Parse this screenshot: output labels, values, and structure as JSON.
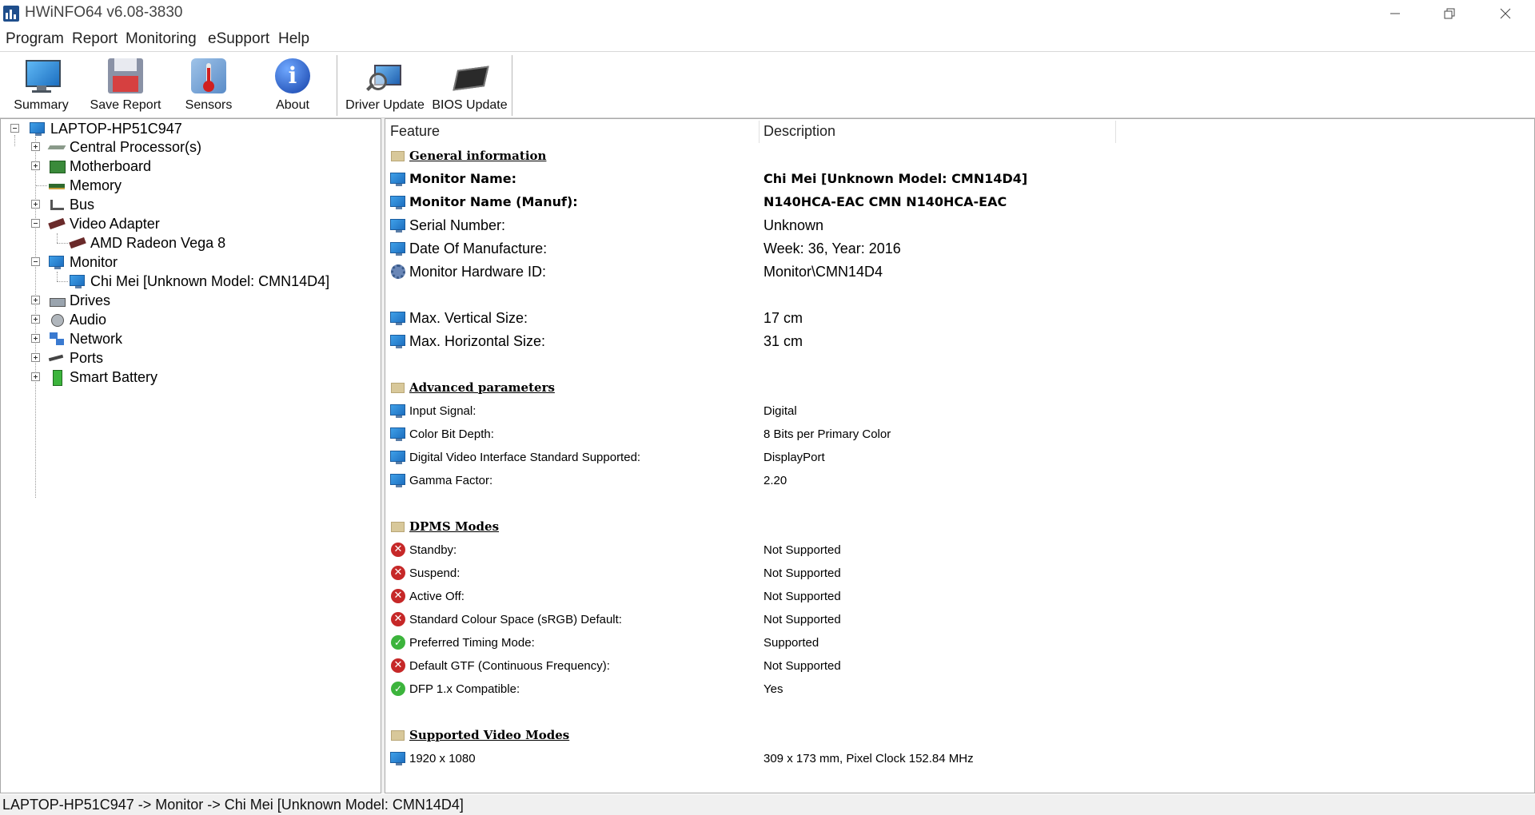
{
  "window": {
    "title": "HWiNFO64 v6.08-3830",
    "controls": [
      "minimize",
      "restore",
      "close"
    ]
  },
  "menu": [
    "Program",
    "Report",
    "Monitoring",
    "eSupport",
    "Help"
  ],
  "toolbar": {
    "buttons": [
      {
        "label": "Summary",
        "icon": "monitor-icon"
      },
      {
        "label": "Save Report",
        "icon": "floppy-disk-icon"
      },
      {
        "label": "Sensors",
        "icon": "thermometer-icon"
      },
      {
        "label": "About",
        "icon": "info-icon"
      },
      {
        "label": "Driver Update",
        "icon": "driver-update-icon"
      },
      {
        "label": "BIOS Update",
        "icon": "bios-chip-icon"
      }
    ]
  },
  "tree": {
    "root": "LAPTOP-HP51C947",
    "items": [
      {
        "label": "Central Processor(s)",
        "icon": "cpu-icon",
        "expander": "plus"
      },
      {
        "label": "Motherboard",
        "icon": "motherboard-icon",
        "expander": "plus"
      },
      {
        "label": "Memory",
        "icon": "memory-icon",
        "expander": "none"
      },
      {
        "label": "Bus",
        "icon": "bus-icon",
        "expander": "plus"
      },
      {
        "label": "Video Adapter",
        "icon": "video-card-icon",
        "expander": "minus"
      },
      {
        "label": "AMD Radeon Vega 8",
        "icon": "video-card-icon",
        "expander": "child"
      },
      {
        "label": "Monitor",
        "icon": "monitor-icon",
        "expander": "minus"
      },
      {
        "label": "Chi Mei [Unknown Model: CMN14D4]",
        "icon": "monitor-icon",
        "expander": "child"
      },
      {
        "label": "Drives",
        "icon": "drive-icon",
        "expander": "plus"
      },
      {
        "label": "Audio",
        "icon": "speaker-icon",
        "expander": "plus"
      },
      {
        "label": "Network",
        "icon": "network-icon",
        "expander": "plus"
      },
      {
        "label": "Ports",
        "icon": "port-icon",
        "expander": "plus"
      },
      {
        "label": "Smart Battery",
        "icon": "battery-icon",
        "expander": "plus"
      }
    ]
  },
  "columns": {
    "feature": "Feature",
    "description": "Description"
  },
  "details": [
    {
      "type": "section",
      "feature": "General information",
      "desc": ""
    },
    {
      "type": "bigbold",
      "icon": "monitor",
      "feature": "Monitor Name:",
      "desc": "Chi Mei [Unknown Model: CMN14D4]"
    },
    {
      "type": "bigbold",
      "icon": "monitor",
      "feature": "Monitor Name (Manuf):",
      "desc": "N140HCA-EAC  CMN        N140HCA-EAC"
    },
    {
      "type": "big",
      "icon": "monitor",
      "feature": "Serial Number:",
      "desc": "Unknown"
    },
    {
      "type": "big",
      "icon": "monitor",
      "feature": "Date Of Manufacture:",
      "desc": "Week: 36, Year: 2016"
    },
    {
      "type": "big",
      "icon": "gear",
      "feature": "Monitor Hardware ID:",
      "desc": "Monitor\\CMN14D4"
    },
    {
      "type": "blank"
    },
    {
      "type": "big",
      "icon": "monitor",
      "feature": "Max. Vertical Size:",
      "desc": "17 cm"
    },
    {
      "type": "big",
      "icon": "monitor",
      "feature": "Max. Horizontal Size:",
      "desc": "31 cm"
    },
    {
      "type": "blank"
    },
    {
      "type": "section",
      "feature": "Advanced parameters",
      "desc": ""
    },
    {
      "type": "small",
      "icon": "monitor",
      "feature": "Input Signal:",
      "desc": "Digital"
    },
    {
      "type": "small",
      "icon": "monitor",
      "feature": "Color Bit Depth:",
      "desc": "8 Bits per Primary Color"
    },
    {
      "type": "small",
      "icon": "monitor",
      "feature": "Digital Video Interface Standard Supported:",
      "desc": "DisplayPort"
    },
    {
      "type": "small",
      "icon": "monitor",
      "feature": "Gamma Factor:",
      "desc": "2.20"
    },
    {
      "type": "blank"
    },
    {
      "type": "section",
      "feature": "DPMS Modes",
      "desc": ""
    },
    {
      "type": "small",
      "icon": "bad",
      "feature": "Standby:",
      "desc": "Not Supported"
    },
    {
      "type": "small",
      "icon": "bad",
      "feature": "Suspend:",
      "desc": "Not Supported"
    },
    {
      "type": "small",
      "icon": "bad",
      "feature": "Active Off:",
      "desc": "Not Supported"
    },
    {
      "type": "small",
      "icon": "bad",
      "feature": "Standard Colour Space (sRGB) Default:",
      "desc": "Not Supported"
    },
    {
      "type": "small",
      "icon": "ok",
      "feature": "Preferred Timing Mode:",
      "desc": "Supported"
    },
    {
      "type": "small",
      "icon": "bad",
      "feature": "Default GTF (Continuous Frequency):",
      "desc": "Not Supported"
    },
    {
      "type": "small",
      "icon": "ok",
      "feature": "DFP 1.x Compatible:",
      "desc": "Yes"
    },
    {
      "type": "blank"
    },
    {
      "type": "section",
      "feature": "Supported Video Modes",
      "desc": ""
    },
    {
      "type": "small",
      "icon": "monitor",
      "feature": "1920 x 1080",
      "desc": "309 x 173 mm, Pixel Clock 152.84 MHz"
    }
  ],
  "status": "LAPTOP-HP51C947 -> Monitor -> Chi Mei [Unknown Model: CMN14D4]"
}
